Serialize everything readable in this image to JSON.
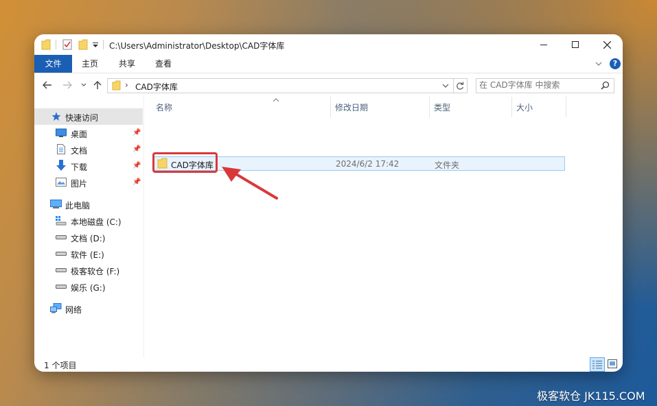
{
  "window": {
    "title_path": "C:\\Users\\Administrator\\Desktop\\CAD字体库"
  },
  "ribbon": {
    "tabs": [
      {
        "label": "文件"
      },
      {
        "label": "主页"
      },
      {
        "label": "共享"
      },
      {
        "label": "查看"
      }
    ],
    "help_label": "?"
  },
  "address": {
    "separator": "›",
    "folder": "CAD字体库",
    "search_placeholder": "在 CAD字体库 中搜索"
  },
  "sidebar": {
    "quick_access": "快速访问",
    "pinned": [
      {
        "label": "桌面"
      },
      {
        "label": "文档"
      },
      {
        "label": "下载"
      },
      {
        "label": "图片"
      }
    ],
    "this_pc": "此电脑",
    "drives": [
      {
        "label": "本地磁盘 (C:)"
      },
      {
        "label": "文档 (D:)"
      },
      {
        "label": "软件 (E:)"
      },
      {
        "label": "极客软仓 (F:)"
      },
      {
        "label": "娱乐 (G:)"
      }
    ],
    "network": "网络"
  },
  "columns": {
    "name": "名称",
    "modified": "修改日期",
    "type": "类型",
    "size": "大小"
  },
  "files": [
    {
      "name": "CAD字体库",
      "modified": "2024/6/2 17:42",
      "type": "文件夹",
      "size": ""
    }
  ],
  "status": {
    "count": "1 个项目"
  },
  "watermark": "极客软仓 JK115.COM",
  "colors": {
    "accent": "#1a5fb4",
    "highlight_box": "#d9383a",
    "selection_bg": "#e9f3fd",
    "folder_yellow": "#f7d465"
  }
}
